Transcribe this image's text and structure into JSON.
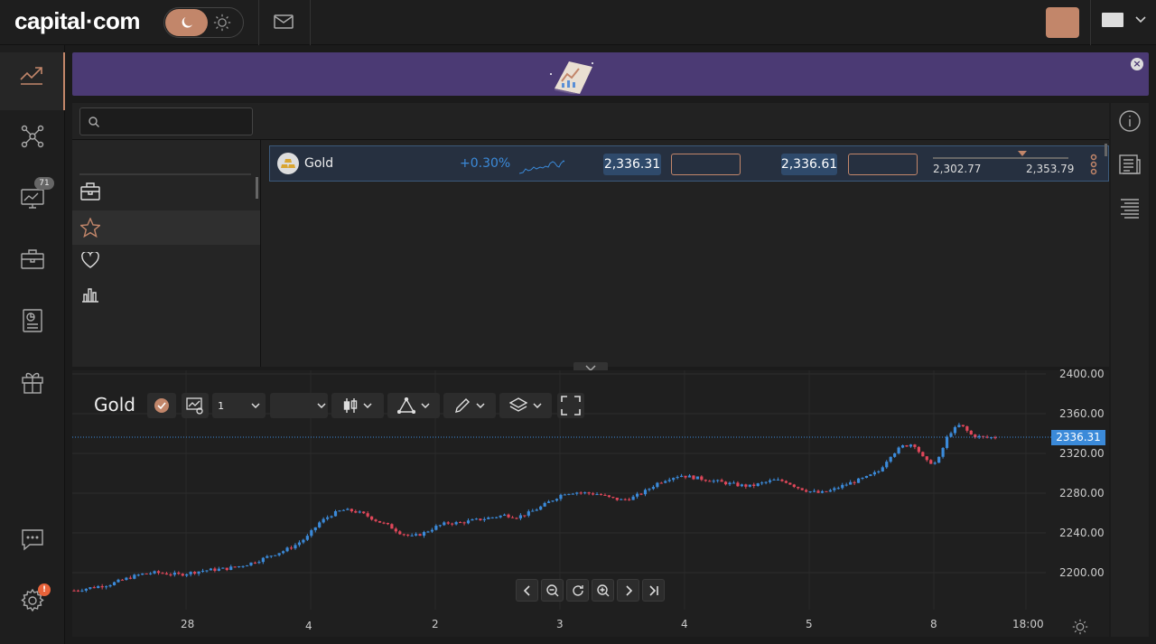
{
  "header": {
    "logo": "capital·com",
    "top_button": "ᅟᅟᅟ",
    "language": "ᅟᅟ"
  },
  "nav": {
    "items": [
      {
        "label": "ᅟᅟ",
        "icon": "trending-up-icon"
      },
      {
        "label": "ᅟᅟ",
        "icon": "network-icon"
      },
      {
        "label": "ᅟᅟᅟ",
        "icon": "monitor-chart-icon",
        "badge": "71"
      },
      {
        "label": "ᅟᅟᅟᅟ",
        "icon": "briefcase-icon"
      },
      {
        "label": "ᅟᅟ",
        "icon": "report-icon"
      },
      {
        "label": "ᅟᅟᅟ",
        "icon": "gift-icon"
      },
      {
        "label": "ᅟᅟᅟᅟ",
        "icon": "chat-icon"
      },
      {
        "label": "ᅟᅟ",
        "icon": "gear-icon",
        "badge": "!"
      }
    ]
  },
  "banner": {
    "title": "ᅟᅟᅟᅟ",
    "subtitle": "ᅟᅟᅟᅟᅟᅟᅟᅟᅟᅟᅟᅟᅟᅟᅟᅟᅟᅟᅟᅟ",
    "close": "×"
  },
  "watchlist": {
    "search_placeholder": "ᅟᅟ",
    "columns": [
      "ᅟᅟ",
      "ᅟᅟ",
      "ᅟᅟ",
      "ᅟᅟ",
      "ᅟᅟ",
      "ᅟᅟ"
    ],
    "lists_header": "ᅟᅟᅟᅟ",
    "lists_edit": "ᅟᅟ",
    "lists": [
      {
        "label": "ᅟᅟᅟᅟ",
        "icon": "briefcase-icon"
      },
      {
        "label": "ᅟᅟ",
        "icon": "star-icon"
      },
      {
        "label": "ᅟᅟᅟᅟ",
        "icon": "heart-icon"
      },
      {
        "label": "ᅟᅟᅟ",
        "icon": "bar-chart-icon"
      }
    ],
    "category_header": "ᅟᅟ",
    "category_item": "ᅟᅟᅟᅟ"
  },
  "instrument": {
    "name": "Gold",
    "change": "+0.30%",
    "sell_price": "2,336.31",
    "sell_label": "ᅟᅟ",
    "buy_price": "2,336.61",
    "buy_label": "ᅟᅟ",
    "low": "2,302.77",
    "high": "2,353.79"
  },
  "chart": {
    "title": "Gold",
    "timeframe": "1 ᅟᅟ",
    "indicator": "ᅟᅟᅟᅟᅟᅟ",
    "current_price": "2336.31",
    "y_labels": [
      "2400.00",
      "2360.00",
      "2320.00",
      "2280.00",
      "2240.00",
      "2200.00"
    ],
    "x_labels": [
      "28",
      "4ᅟ",
      "2",
      "3",
      "4",
      "5",
      "8",
      "18:00"
    ]
  },
  "chart_data": {
    "type": "candlestick",
    "x_ticks": [
      "28",
      "4ᅟ",
      "2",
      "3",
      "4",
      "5",
      "8",
      "18:00"
    ],
    "ylim": [
      2180,
      2405
    ],
    "y_ticks": [
      2200,
      2240,
      2280,
      2320,
      2360,
      2400
    ],
    "last_price": 2336.31,
    "close_path": [
      2182,
      2184,
      2186,
      2188,
      2192,
      2196,
      2199,
      2200,
      2199,
      2198,
      2200,
      2202,
      2203,
      2204,
      2206,
      2209,
      2213,
      2218,
      2222,
      2228,
      2236,
      2250,
      2258,
      2263,
      2262,
      2258,
      2252,
      2247,
      2240,
      2236,
      2240,
      2246,
      2250,
      2250,
      2252,
      2254,
      2256,
      2258,
      2256,
      2260,
      2266,
      2273,
      2280,
      2281,
      2280,
      2279,
      2275,
      2273,
      2276,
      2282,
      2290,
      2295,
      2298,
      2296,
      2294,
      2292,
      2290,
      2288,
      2287,
      2290,
      2293,
      2292,
      2286,
      2282,
      2280,
      2283,
      2288,
      2292,
      2296,
      2302,
      2318,
      2327,
      2330,
      2312,
      2310,
      2340,
      2349,
      2338,
      2336,
      2336
    ],
    "up_color": "#3b8ad9",
    "down_color": "#e0475a"
  }
}
